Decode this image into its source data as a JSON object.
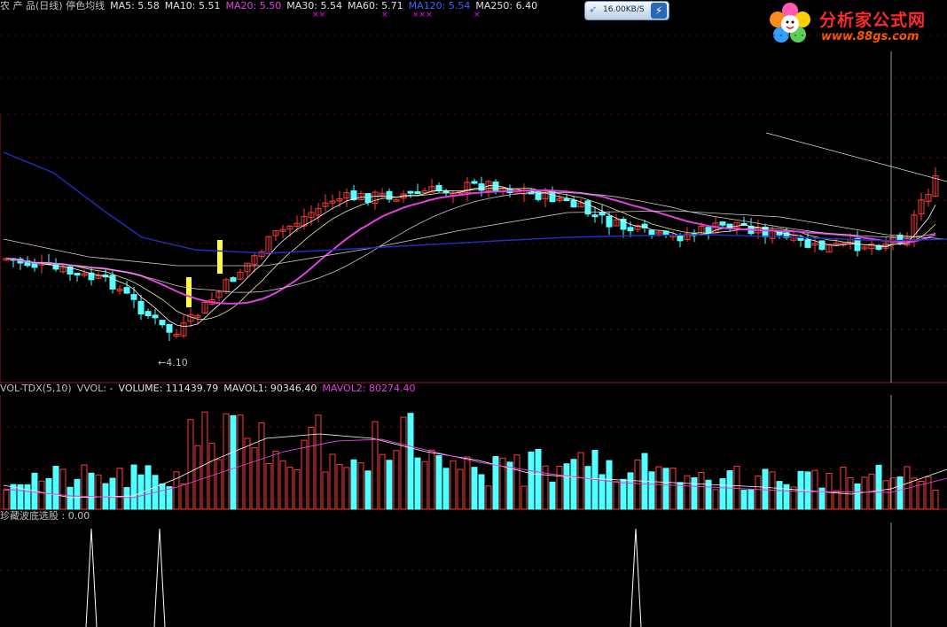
{
  "top_legend": [
    {
      "text": "农 产 品(日线) 停色均线",
      "color": "#c0c0c0"
    },
    {
      "text": "MA5: 5.58",
      "color": "#e0e0e0"
    },
    {
      "text": "MA10: 5.51",
      "color": "#e0e0e0"
    },
    {
      "text": "MA20: 5.50",
      "color": "#e040e0"
    },
    {
      "text": "MA30: 5.54",
      "color": "#e0e0e0"
    },
    {
      "text": "MA60: 5.71",
      "color": "#e0e0e0"
    },
    {
      "text": "MA120: 5.54",
      "color": "#4060ff"
    },
    {
      "text": "MA250: 6.40",
      "color": "#e0e0e0"
    }
  ],
  "speed_widget": {
    "label": "16.00KB/S"
  },
  "logo": {
    "name": "分析家公式网",
    "url": "www.88gs.com"
  },
  "low_label": "4.10",
  "markers": [
    "××",
    "×",
    "×××",
    "×"
  ],
  "volume_legend": [
    {
      "text": "VOL-TDX(5,10)",
      "color": "#c0c0c0"
    },
    {
      "text": "VVOL: -",
      "color": "#c0c0c0"
    },
    {
      "text": "VOLUME: 111439.79",
      "color": "#e0e0e0"
    },
    {
      "text": "MAVOL1: 90346.40",
      "color": "#e0e0e0"
    },
    {
      "text": "MAVOL2: 80274.40",
      "color": "#e040e0"
    }
  ],
  "indicator_legend": {
    "text": "珍藏波底选股 : 0.00"
  },
  "colors": {
    "up": "#ff3a3a",
    "down": "#54ffff",
    "ma20": "#e040e0",
    "ma120": "#2030c0",
    "highlight": "#ffff40",
    "frame": "#a01818"
  }
}
